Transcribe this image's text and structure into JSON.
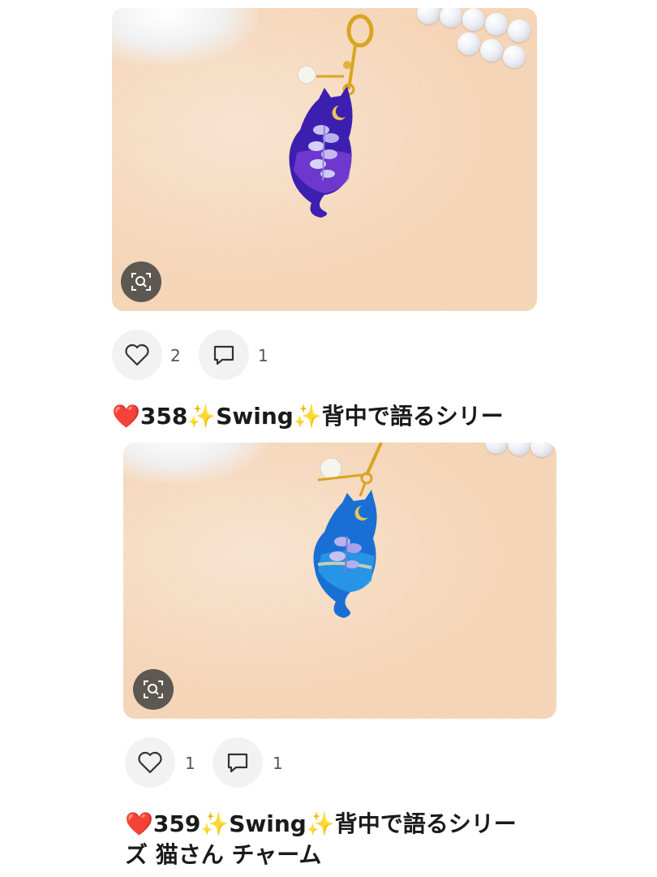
{
  "posts": [
    {
      "likes": "2",
      "comments": "1",
      "title": {
        "heart": "❤️",
        "number": "358",
        "sparkle_left": "✨",
        "name": "Swing",
        "sparkle_right": "✨",
        "rest": "背中で語るシリー"
      },
      "image": {
        "subject": "purple cat resin charm",
        "body_color": "#3d1fb0",
        "accent_color": "#7b3fd6"
      }
    },
    {
      "likes": "1",
      "comments": "1",
      "title": {
        "heart": "❤️",
        "number": "359",
        "sparkle_left": "✨",
        "name": "Swing",
        "sparkle_right": "✨",
        "rest": "背中で語るシリー",
        "line2": "ズ 猫さん チャーム"
      },
      "image": {
        "subject": "blue cat resin charm",
        "body_color": "#1a6fd4",
        "accent_color": "#2a9be8"
      }
    }
  ],
  "icons": {
    "lens": "image-search-icon",
    "like": "heart-outline-icon",
    "comment": "comment-icon"
  }
}
